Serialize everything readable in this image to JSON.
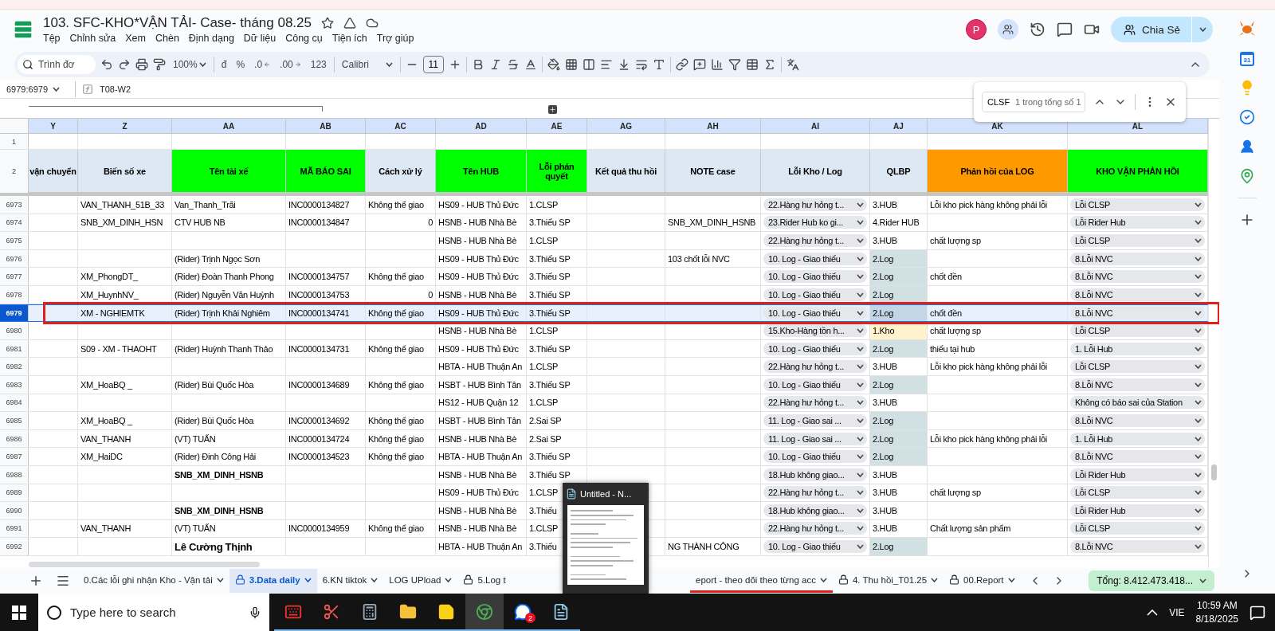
{
  "app": {
    "title": "103. SFC-KHO*VẬN TẢI- Case- tháng 08.25",
    "menus": [
      "Tệp",
      "Chỉnh sửa",
      "Xem",
      "Chèn",
      "Định dạng",
      "Dữ liệu",
      "Công cụ",
      "Tiện ích",
      "Trợ giúp"
    ],
    "avatar": "P",
    "share": "Chia Sẻ"
  },
  "toolbar": {
    "search_placeholder": "Trình đơ",
    "zoom": "100%",
    "currency": "đ",
    "percent": "%",
    "decrease_decimal": ".0",
    "increase_decimal": ".00",
    "number_format": "123",
    "font": "Calibri",
    "font_size": "11"
  },
  "formula_bar": {
    "cell_ref": "6979:6979",
    "value": "T08-W2"
  },
  "find": {
    "query": "CLSF",
    "result": "1 trong tổng số 1"
  },
  "sidebar": {
    "calendar_day": "31"
  },
  "sheet": {
    "top_rows": [
      "1",
      "2"
    ],
    "columns": [
      {
        "letter": "Y",
        "header": "vận chuyển",
        "color": "#dde8f5",
        "kind": "text"
      },
      {
        "letter": "Z",
        "header": "Biến số xe",
        "color": "#dde8f5",
        "kind": "text"
      },
      {
        "letter": "AA",
        "header": "Tên tài xế",
        "color": "#00ff00",
        "kind": "text"
      },
      {
        "letter": "AB",
        "header": "MÃ BÁO SAI",
        "color": "#00ff00",
        "kind": "text"
      },
      {
        "letter": "AC",
        "header": "Cách xử lý",
        "color": "#dde8f5",
        "kind": "text"
      },
      {
        "letter": "AD",
        "header": "Tên HUB",
        "color": "#00ff00",
        "kind": "text"
      },
      {
        "letter": "AE",
        "header": "Lỗi phán quyết",
        "color": "#00ff00",
        "kind": "text"
      },
      {
        "letter": "AG",
        "header": "Kết quả thu hồi",
        "color": "#dde8f5",
        "kind": "text"
      },
      {
        "letter": "AH",
        "header": "NOTE case",
        "color": "#dde8f5",
        "kind": "text"
      },
      {
        "letter": "AI",
        "header": "Lỗi Kho / Log",
        "color": "#dde8f5",
        "kind": "dropdown"
      },
      {
        "letter": "AJ",
        "header": "QLBP",
        "color": "#dde8f5",
        "kind": "status"
      },
      {
        "letter": "AK",
        "header": "Phản hồi của LOG",
        "color": "#ff9900",
        "kind": "text"
      },
      {
        "letter": "AL",
        "header": "KHO VẬN PHẢN HỒI",
        "color": "#00ff00",
        "kind": "dropdown"
      }
    ],
    "rows": [
      {
        "number": "6973",
        "selected": false,
        "cells": [
          null,
          "VAN_THANH_51B_33",
          "Van_Thanh_Trãi",
          "INC0000134827",
          "Không thể giao",
          "HS09 - HUB Thủ Đức",
          "1.CLSP",
          null,
          null,
          "22.Hàng hư hỏng t...",
          {
            "text": "3.HUB",
            "color": "#ffffff"
          },
          "Lỗi kho pick hàng không phải lỗi",
          "Lỗi CLSP"
        ]
      },
      {
        "number": "6974",
        "selected": false,
        "cells": [
          null,
          "SNB_XM_DINH_HSN",
          "CTV HUB NB",
          "INC0000134847",
          {
            "text": "0",
            "kind": "number"
          },
          "HSNB - HUB Nhà Bè",
          "3.Thiếu SP",
          null,
          "SNB_XM_DINH_HSNB",
          "23.Rider Hub ko gi...",
          {
            "text": "4.Rider HUB",
            "color": "#ffffff"
          },
          null,
          "Lỗi Rider Hub"
        ]
      },
      {
        "number": "6975",
        "selected": false,
        "cells": [
          null,
          null,
          null,
          null,
          null,
          "HSNB - HUB Nhà Bè",
          "1.CLSP",
          null,
          null,
          "22.Hàng hư hỏng t...",
          {
            "text": "3.HUB",
            "color": "#ffffff"
          },
          "chất lượng sp",
          "Lỗi CLSP"
        ]
      },
      {
        "number": "6976",
        "selected": false,
        "cells": [
          null,
          null,
          "(Rider) Trịnh Ngọc Sơn",
          null,
          null,
          "HS09 - HUB Thủ Đức",
          "3.Thiếu SP",
          null,
          "103 chốt lỗi NVC",
          "10. Log - Giao thiếu",
          {
            "text": "2.Log",
            "color": "#d0e0e3"
          },
          null,
          "8.Lỗi NVC"
        ]
      },
      {
        "number": "6977",
        "selected": false,
        "cells": [
          null,
          "XM_PhongDT_",
          "(Rider) Đoàn Thanh Phong",
          "INC0000134757",
          "Không thể giao",
          "HS09 - HUB Thủ Đức",
          "3.Thiếu SP",
          null,
          null,
          "10. Log - Giao thiếu",
          {
            "text": "2.Log",
            "color": "#d0e0e3"
          },
          "chốt đền",
          "8.Lỗi NVC"
        ]
      },
      {
        "number": "6978",
        "selected": false,
        "cells": [
          null,
          "XM_HuynhNV_",
          "(Rider) Nguyễn Văn Huỳnh",
          "INC0000134753",
          {
            "text": "0",
            "kind": "number"
          },
          "HSNB - HUB Nhà Bè",
          "3.Thiếu SP",
          null,
          null,
          "10. Log - Giao thiếu",
          {
            "text": "2.Log",
            "color": "#d0e0e3"
          },
          null,
          "8.Lỗi NVC"
        ]
      },
      {
        "number": "6979",
        "selected": true,
        "cells": [
          null,
          "XM - NGHIEMTK",
          "(Rider) Trịnh Khải Nghiêm",
          "INC0000134741",
          "Không thể giao",
          "HS09 - HUB Thủ Đức",
          "3.Thiếu SP",
          null,
          null,
          "10. Log - Giao thiếu",
          {
            "text": "2.Log",
            "color": "#c3d6e8"
          },
          "chốt đền",
          "8.Lỗi NVC"
        ]
      },
      {
        "number": "6980",
        "selected": false,
        "cells": [
          null,
          null,
          null,
          null,
          null,
          "HSNB - HUB Nhà Bè",
          "1.CLSP",
          null,
          null,
          "15.Kho-Hàng tồn h...",
          {
            "text": "1.Kho",
            "color": "#fff2cc"
          },
          "chất lượng sp",
          "Lỗi CLSP"
        ]
      },
      {
        "number": "6981",
        "selected": false,
        "cells": [
          null,
          "S09 - XM - THAOHT",
          "(Rider) Huỳnh Thanh Thảo",
          "INC0000134731",
          "Không thể giao",
          "HS09 - HUB Thủ Đức",
          "3.Thiếu SP",
          null,
          null,
          "10. Log - Giao thiếu",
          {
            "text": "2.Log",
            "color": "#d0e0e3"
          },
          "thiếu tại hub",
          "1. Lỗi Hub"
        ]
      },
      {
        "number": "6982",
        "selected": false,
        "cells": [
          null,
          null,
          null,
          null,
          null,
          "HBTA - HUB Thuận An",
          "1.CLSP",
          null,
          null,
          "22.Hàng hư hỏng t...",
          {
            "text": "3.HUB",
            "color": "#ffffff"
          },
          "Lỗi kho pick hàng không phải lỗi",
          "Lỗi CLSP"
        ]
      },
      {
        "number": "6983",
        "selected": false,
        "cells": [
          null,
          "XM_HoaBQ _",
          "(Rider) Bùi Quốc Hòa",
          "INC0000134689",
          "Không thể giao",
          "HSBT - HUB Bình Tân",
          "3.Thiếu SP",
          null,
          null,
          "10. Log - Giao thiếu",
          {
            "text": "2.Log",
            "color": "#d0e0e3"
          },
          null,
          "8.Lỗi NVC"
        ]
      },
      {
        "number": "6984",
        "selected": false,
        "cells": [
          null,
          null,
          null,
          null,
          null,
          "HS12 - HUB Quận 12",
          "1.CLSP",
          null,
          null,
          "22.Hàng hư hỏng t...",
          {
            "text": "3.HUB",
            "color": "#ffffff"
          },
          null,
          "Không có báo sai của Station"
        ]
      },
      {
        "number": "6985",
        "selected": false,
        "cells": [
          null,
          "XM_HoaBQ _",
          "(Rider) Bùi Quốc Hòa",
          "INC0000134692",
          "Không thể giao",
          "HSBT - HUB Bình Tân",
          "2.Sai SP",
          null,
          null,
          "11. Log - Giao sai ...",
          {
            "text": "2.Log",
            "color": "#d0e0e3"
          },
          null,
          "8.Lỗi NVC"
        ]
      },
      {
        "number": "6986",
        "selected": false,
        "cells": [
          null,
          "VAN_THANH",
          "(VT) TUẤN",
          "INC0000134724",
          "Không thể giao",
          "HSNB - HUB Nhà Bè",
          "2.Sai SP",
          null,
          null,
          "11. Log - Giao sai ...",
          {
            "text": "2.Log",
            "color": "#d0e0e3"
          },
          "Lỗi kho pick hàng không phải lỗi",
          "1. Lỗi Hub"
        ]
      },
      {
        "number": "6987",
        "selected": false,
        "cells": [
          null,
          "XM_HaiDC",
          "(Rider) Đinh Công Hải",
          "INC0000134523",
          "Không thể giao",
          "HBTA - HUB Thuận An",
          "3.Thiếu SP",
          null,
          null,
          "10. Log - Giao thiếu",
          {
            "text": "2.Log",
            "color": "#d0e0e3"
          },
          null,
          "8.Lỗi NVC"
        ]
      },
      {
        "number": "6988",
        "selected": false,
        "cells": [
          null,
          null,
          {
            "text": "SNB_XM_DINH_HSNB",
            "kind": "bold"
          },
          null,
          null,
          "HSNB - HUB Nhà Bè",
          "3.Thiếu SP",
          null,
          null,
          "18.Hub không giao...",
          {
            "text": "3.HUB",
            "color": "#ffffff"
          },
          null,
          "Lỗi Rider Hub"
        ]
      },
      {
        "number": "6989",
        "selected": false,
        "cells": [
          null,
          null,
          null,
          null,
          null,
          "HS09 - HUB Thủ Đức",
          "1.CLSP",
          null,
          null,
          "22.Hàng hư hỏng t...",
          {
            "text": "3.HUB",
            "color": "#ffffff"
          },
          "chất lượng sp",
          "Lỗi CLSP"
        ]
      },
      {
        "number": "6990",
        "selected": false,
        "cells": [
          null,
          null,
          {
            "text": "SNB_XM_DINH_HSNB",
            "kind": "bold"
          },
          null,
          null,
          "HSNB - HUB Nhà Bè",
          "3.Thiếu",
          null,
          null,
          "18.Hub không giao...",
          {
            "text": "3.HUB",
            "color": "#ffffff"
          },
          null,
          "Lỗi Rider Hub"
        ]
      },
      {
        "number": "6991",
        "selected": false,
        "cells": [
          null,
          "VAN_THANH",
          "(VT) TUẤN",
          "INC0000134959",
          "Không thể giao",
          "HSNB - HUB Nhà Bè",
          "1.CLSP",
          null,
          null,
          "22.Hàng hư hỏng t...",
          {
            "text": "3.HUB",
            "color": "#ffffff"
          },
          "Chất lượng sản phẩm",
          "Lỗi CLSP"
        ]
      },
      {
        "number": "6992",
        "selected": false,
        "cells": [
          null,
          null,
          {
            "text": "Lê Cường Thịnh",
            "kind": "large-bold"
          },
          null,
          null,
          "HBTA - HUB Thuận An",
          "3.Thiếu",
          null,
          "NG THÀNH CÔNG",
          "10. Log - Giao thiếu",
          {
            "text": "2.Log",
            "color": "#d0e0e3"
          },
          null,
          "8.Lỗi NVC"
        ]
      }
    ]
  },
  "tabs": [
    {
      "label": "0.Các lỗi ghi nhận Kho - Vận tải",
      "locked": false,
      "selected": false,
      "caret": true
    },
    {
      "label": "3.Data daily",
      "locked": true,
      "selected": true,
      "caret": true
    },
    {
      "label": "6.KN tiktok",
      "locked": false,
      "selected": false,
      "caret": true
    },
    {
      "label": "LOG UPload",
      "locked": false,
      "selected": false,
      "caret": true
    },
    {
      "label": "5.Log t",
      "locked": true,
      "selected": false,
      "caret": false
    },
    {
      "label": "eport - theo dõi theo từng acc",
      "locked": false,
      "selected": false,
      "caret": true,
      "color": "#e0201c"
    },
    {
      "label": "4. Thu hồi_T01.25",
      "locked": true,
      "selected": false,
      "caret": true
    },
    {
      "label": "00.Report",
      "locked": true,
      "selected": false,
      "caret": true
    }
  ],
  "sum": "Tổng: 8.412.473.418...",
  "taskbar_popup": {
    "title": "Untitled - N..."
  },
  "taskbar": {
    "search_placeholder": "Type here to search",
    "apps": [
      {
        "kind": "keyboard",
        "selected": false
      },
      {
        "kind": "snipping",
        "selected": false
      },
      {
        "kind": "calculator",
        "selected": false
      },
      {
        "kind": "folder",
        "selected": false
      },
      {
        "kind": "sticky-notes",
        "selected": false
      },
      {
        "kind": "chrome",
        "selected": true
      },
      {
        "kind": "chat",
        "selected": false,
        "badge": "2"
      },
      {
        "kind": "notepad",
        "selected": false
      }
    ],
    "language": "VIE",
    "time": "10:59 AM",
    "date": "8/18/2025"
  }
}
